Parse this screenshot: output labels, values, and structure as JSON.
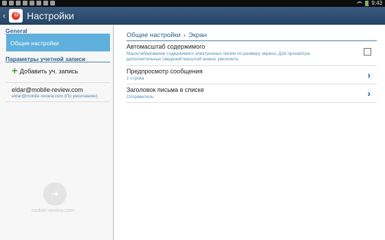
{
  "status_bar": {
    "time": "9:43"
  },
  "action_bar": {
    "title": "Настройки",
    "app_icon_letter": "@"
  },
  "sidebar": {
    "general_header": "General",
    "selected_item": "Общие настройки",
    "account_header": "Параметры учетной записи",
    "add_account": "Добавить уч. запись",
    "account_email": "eldar@mobile-review.com",
    "account_sub": "eldar@mobile-review.com (По умолчанию)"
  },
  "watermark": {
    "text": "mobile-review.com"
  },
  "content": {
    "breadcrumb_parent": "Общие настройки",
    "breadcrumb_sep": "›",
    "breadcrumb_current": "Экран",
    "rows": [
      {
        "title": "Автомасштаб содержимого",
        "subtitle": "Масштабирование содержимого электронных писем по размеру экрана. Для просмотра дополнительных сведений масштаб можно увеличить",
        "control": "checkbox",
        "checked": false
      },
      {
        "title": "Предпросмотр сообщения",
        "subtitle": "1 строка",
        "control": "chevron"
      },
      {
        "title": "Заголовок письма в списке",
        "subtitle": "Отправитель",
        "control": "chevron"
      }
    ]
  },
  "colors": {
    "action_bar": "#264566",
    "accent": "#2b5f87",
    "selected": "#5fb0dc"
  }
}
